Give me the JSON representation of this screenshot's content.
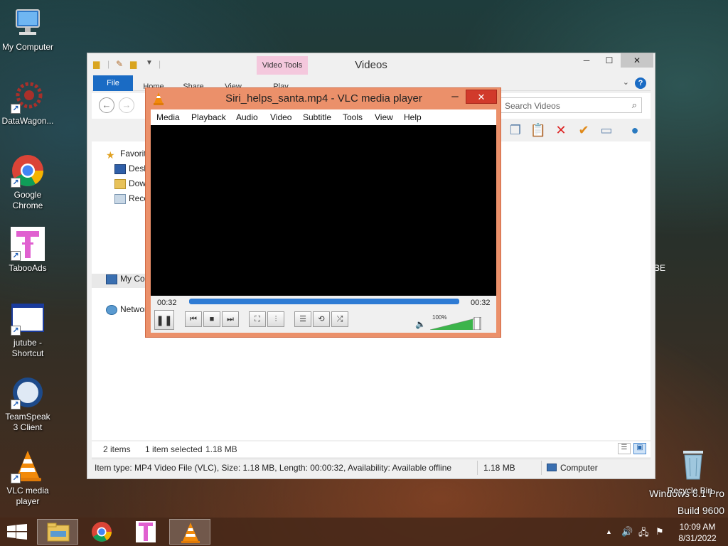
{
  "desktop": {
    "icons": [
      {
        "label": "My Computer"
      },
      {
        "label": "DataWagon..."
      },
      {
        "label": "Google Chrome"
      },
      {
        "label": "TabooAds"
      },
      {
        "label": "jutube - Shortcut"
      },
      {
        "label": "TeamSpeak 3 Client"
      },
      {
        "label": "VLC media player"
      }
    ],
    "recycle_bin": "Recycle Bin",
    "partial_text": "BE",
    "watermark": {
      "line1": "Windows 8.1 Pro",
      "line2": "Build 9600"
    }
  },
  "explorer": {
    "title": "Videos",
    "context_tab": "Video Tools",
    "tabs": [
      "File",
      "Home",
      "Share",
      "View",
      "Play"
    ],
    "search_placeholder": "Search Videos",
    "nav": {
      "favorites": "Favorites",
      "desktop": "Desktop",
      "downloads": "Downloads",
      "recent": "Recent places",
      "computer": "My Computer",
      "network": "Network"
    },
    "status": {
      "items": "2 items",
      "selected": "1 item selected",
      "size": "1.18 MB"
    },
    "details": {
      "info": "Item type: MP4 Video File (VLC), Size: 1.18 MB, Length: 00:00:32, Availability: Available offline",
      "size": "1.18 MB",
      "location": "Computer"
    }
  },
  "vlc": {
    "title": "Siri_helps_santa.mp4 - VLC media player",
    "menu": [
      "Media",
      "Playback",
      "Audio",
      "Video",
      "Subtitle",
      "Tools",
      "View",
      "Help"
    ],
    "time_elapsed": "00:32",
    "time_total": "00:32",
    "progress": 1.0,
    "volume_label": "100%",
    "volume": 1.0
  },
  "taskbar": {
    "time": "10:09 AM",
    "date": "8/31/2022"
  }
}
